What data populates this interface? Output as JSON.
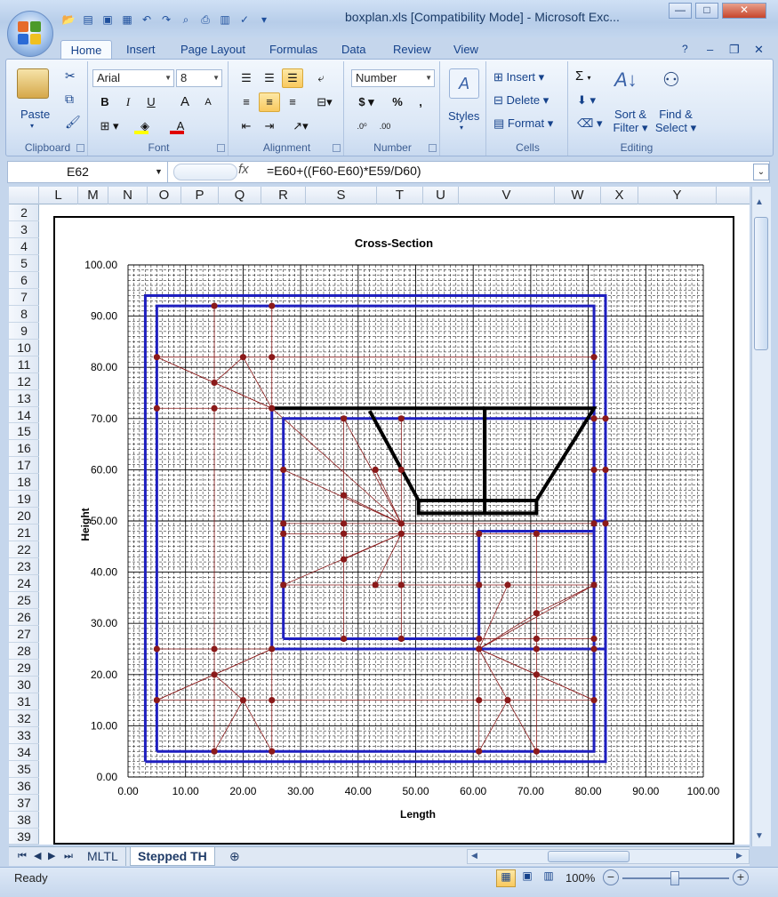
{
  "window": {
    "title": "boxplan.xls  [Compatibility Mode] - Microsoft Exc...",
    "minimize": "—",
    "maximize": "□",
    "close": "✕"
  },
  "ribbon_tabs": [
    "Home",
    "Insert",
    "Page Layout",
    "Formulas",
    "Data",
    "Review",
    "View"
  ],
  "clipboard": {
    "paste": "Paste",
    "label": "Clipboard"
  },
  "font": {
    "name": "Arial",
    "size": "8",
    "bold": "B",
    "italic": "I",
    "underline": "U",
    "grow": "A",
    "shrink": "A",
    "color_letter": "A",
    "label": "Font",
    "fill_color": "#ffff00",
    "text_color": "#e00000"
  },
  "alignment": {
    "label": "Alignment"
  },
  "number": {
    "format": "Number",
    "currency": "$",
    "percent": "%",
    "comma": ",",
    "label": "Number"
  },
  "styles": {
    "label": "Styles"
  },
  "cells": {
    "insert": "Insert",
    "delete": "Delete",
    "format": "Format",
    "label": "Cells"
  },
  "editing": {
    "sum": "Σ",
    "sort": "Sort &",
    "filter": "Filter",
    "find": "Find &",
    "select": "Select",
    "label": "Editing"
  },
  "formula_bar": {
    "name_box": "E62",
    "fx": "fx",
    "formula": "=E60+((F60-E60)*E59/D60)"
  },
  "columns": [
    "L",
    "M",
    "N",
    "O",
    "P",
    "Q",
    "R",
    "S",
    "T",
    "U",
    "V",
    "W",
    "X",
    "Y"
  ],
  "rows": [
    "2",
    "3",
    "4",
    "5",
    "6",
    "7",
    "8",
    "9",
    "10",
    "11",
    "12",
    "13",
    "14",
    "15",
    "16",
    "17",
    "18",
    "19",
    "20",
    "21",
    "22",
    "23",
    "24",
    "25",
    "26",
    "27",
    "28",
    "29",
    "30",
    "31",
    "32",
    "33",
    "34",
    "35",
    "36",
    "37",
    "38",
    "39"
  ],
  "sheet_tabs": [
    "MLTL",
    "Stepped TH"
  ],
  "status": {
    "ready": "Ready",
    "zoom": "100%"
  },
  "chart_data": {
    "type": "scatter",
    "title": "Cross-Section",
    "xlabel": "Length",
    "ylabel": "Height",
    "xlim": [
      0,
      100
    ],
    "ylim": [
      0,
      100
    ],
    "xticks": [
      "0.00",
      "10.00",
      "20.00",
      "30.00",
      "40.00",
      "50.00",
      "60.00",
      "70.00",
      "80.00",
      "90.00",
      "100.00"
    ],
    "yticks": [
      "0.00",
      "10.00",
      "20.00",
      "30.00",
      "40.00",
      "50.00",
      "60.00",
      "70.00",
      "80.00",
      "90.00",
      "100.00"
    ],
    "grid": true,
    "colors": {
      "box": "#1f1fbf",
      "mesh": "#8b1a1a",
      "hopper": "#000000"
    },
    "blue_boxes": [
      [
        [
          3,
          3
        ],
        [
          83,
          3
        ],
        [
          83,
          94
        ],
        [
          3,
          94
        ],
        [
          3,
          3
        ]
      ],
      [
        [
          5,
          5
        ],
        [
          81,
          5
        ],
        [
          81,
          92
        ],
        [
          5,
          92
        ],
        [
          5,
          92
        ],
        [
          5,
          5
        ]
      ],
      [
        [
          25,
          25
        ],
        [
          83,
          25
        ],
        [
          83,
          50
        ],
        [
          81,
          50
        ],
        [
          81,
          72
        ],
        [
          25,
          72
        ],
        [
          25,
          25
        ]
      ],
      [
        [
          27,
          27
        ],
        [
          61,
          27
        ],
        [
          61,
          48
        ],
        [
          81,
          48
        ],
        [
          81,
          70
        ],
        [
          27,
          70
        ],
        [
          27,
          27
        ]
      ]
    ],
    "hopper": [
      [
        42,
        71.5
      ],
      [
        50.5,
        54
      ],
      [
        50.5,
        51.5
      ],
      [
        71,
        51.5
      ],
      [
        71,
        54
      ],
      [
        62,
        54
      ],
      [
        62,
        72
      ],
      [
        81,
        72
      ],
      [
        71,
        54
      ]
    ],
    "hopper_frame": [
      [
        [
          62,
          72
        ],
        [
          25,
          72
        ]
      ],
      [
        [
          62,
          72
        ],
        [
          62,
          51.5
        ]
      ],
      [
        [
          50.5,
          54
        ],
        [
          71,
          54
        ]
      ]
    ],
    "mesh_lines": [
      [
        [
          15,
          92
        ],
        [
          15,
          77
        ]
      ],
      [
        [
          25,
          92
        ],
        [
          25,
          72
        ]
      ],
      [
        [
          5,
          82
        ],
        [
          15,
          77
        ]
      ],
      [
        [
          15,
          77
        ],
        [
          20,
          82
        ]
      ],
      [
        [
          20,
          82
        ],
        [
          25,
          72
        ]
      ],
      [
        [
          5,
          82
        ],
        [
          25,
          72
        ]
      ],
      [
        [
          15,
          77
        ],
        [
          25,
          72
        ]
      ],
      [
        [
          5,
          72
        ],
        [
          25,
          72
        ]
      ],
      [
        [
          15,
          72
        ],
        [
          15,
          5
        ]
      ],
      [
        [
          25,
          72
        ],
        [
          25,
          5
        ]
      ],
      [
        [
          5,
          25
        ],
        [
          81,
          25
        ]
      ],
      [
        [
          5,
          15
        ],
        [
          81,
          15
        ]
      ],
      [
        [
          25,
          72
        ],
        [
          47.5,
          49.5
        ]
      ],
      [
        [
          27,
          60
        ],
        [
          47.5,
          49.5
        ]
      ],
      [
        [
          37.5,
          55
        ],
        [
          47.5,
          49.5
        ]
      ],
      [
        [
          37.5,
          70
        ],
        [
          47.5,
          49.5
        ]
      ],
      [
        [
          43,
          60
        ],
        [
          47.5,
          49.5
        ]
      ],
      [
        [
          47.5,
          70
        ],
        [
          47.5,
          27
        ]
      ],
      [
        [
          27,
          49.5
        ],
        [
          81,
          49.5
        ]
      ],
      [
        [
          27,
          47.5
        ],
        [
          81,
          47.5
        ]
      ],
      [
        [
          37.5,
          70
        ],
        [
          37.5,
          27
        ]
      ],
      [
        [
          27,
          37.5
        ],
        [
          47.5,
          47.5
        ]
      ],
      [
        [
          37.5,
          42.5
        ],
        [
          47.5,
          47.5
        ]
      ],
      [
        [
          43,
          37.5
        ],
        [
          47.5,
          47.5
        ]
      ],
      [
        [
          27,
          37.5
        ],
        [
          81,
          37.5
        ]
      ],
      [
        [
          61,
          47.5
        ],
        [
          61,
          5
        ]
      ],
      [
        [
          71,
          47.5
        ],
        [
          71,
          5
        ]
      ],
      [
        [
          61,
          25
        ],
        [
          71,
          32
        ]
      ],
      [
        [
          61,
          25
        ],
        [
          81,
          37.5
        ]
      ],
      [
        [
          66,
          37.5
        ],
        [
          61,
          25
        ]
      ],
      [
        [
          61,
          25
        ],
        [
          71,
          20
        ]
      ],
      [
        [
          61,
          25
        ],
        [
          81,
          15
        ]
      ],
      [
        [
          61,
          25
        ],
        [
          66,
          15
        ]
      ],
      [
        [
          66,
          15
        ],
        [
          61,
          5
        ]
      ],
      [
        [
          66,
          15
        ],
        [
          71,
          5
        ]
      ],
      [
        [
          71,
          20
        ],
        [
          81,
          15
        ]
      ],
      [
        [
          71,
          32
        ],
        [
          81,
          37.5
        ]
      ],
      [
        [
          25,
          25
        ],
        [
          5,
          15
        ]
      ],
      [
        [
          25,
          25
        ],
        [
          15,
          20
        ]
      ],
      [
        [
          15,
          20
        ],
        [
          20,
          15
        ]
      ],
      [
        [
          20,
          15
        ],
        [
          15,
          5
        ]
      ],
      [
        [
          20,
          15
        ],
        [
          25,
          5
        ]
      ],
      [
        [
          15,
          20
        ],
        [
          5,
          15
        ]
      ],
      [
        [
          81,
          82
        ],
        [
          81,
          5
        ]
      ],
      [
        [
          83,
          72
        ],
        [
          83,
          48
        ]
      ],
      [
        [
          81,
          60
        ],
        [
          83,
          60
        ]
      ],
      [
        [
          81,
          70
        ],
        [
          83,
          70
        ]
      ],
      [
        [
          81,
          27
        ],
        [
          81,
          25
        ]
      ],
      [
        [
          61,
          27
        ],
        [
          81,
          27
        ]
      ],
      [
        [
          5,
          82
        ],
        [
          81,
          82
        ]
      ]
    ],
    "points": [
      [
        15,
        92
      ],
      [
        25,
        92
      ],
      [
        5,
        82
      ],
      [
        20,
        82
      ],
      [
        25,
        82
      ],
      [
        81,
        82
      ],
      [
        15,
        77
      ],
      [
        5,
        72
      ],
      [
        15,
        72
      ],
      [
        25,
        72
      ],
      [
        37.5,
        70
      ],
      [
        47.5,
        70
      ],
      [
        81,
        70
      ],
      [
        83,
        70
      ],
      [
        27,
        60
      ],
      [
        43,
        60
      ],
      [
        47.5,
        60
      ],
      [
        81,
        60
      ],
      [
        83,
        60
      ],
      [
        37.5,
        55
      ],
      [
        27,
        49.5
      ],
      [
        37.5,
        49.5
      ],
      [
        47.5,
        49.5
      ],
      [
        81,
        49.5
      ],
      [
        83,
        49.5
      ],
      [
        27,
        47.5
      ],
      [
        37.5,
        47.5
      ],
      [
        47.5,
        47.5
      ],
      [
        61,
        47.5
      ],
      [
        71,
        47.5
      ],
      [
        37.5,
        42.5
      ],
      [
        27,
        37.5
      ],
      [
        43,
        37.5
      ],
      [
        47.5,
        37.5
      ],
      [
        61,
        37.5
      ],
      [
        66,
        37.5
      ],
      [
        81,
        37.5
      ],
      [
        71,
        32
      ],
      [
        37.5,
        27
      ],
      [
        47.5,
        27
      ],
      [
        61,
        27
      ],
      [
        71,
        27
      ],
      [
        81,
        27
      ],
      [
        5,
        25
      ],
      [
        15,
        25
      ],
      [
        25,
        25
      ],
      [
        61,
        25
      ],
      [
        71,
        25
      ],
      [
        81,
        25
      ],
      [
        15,
        20
      ],
      [
        71,
        20
      ],
      [
        5,
        15
      ],
      [
        20,
        15
      ],
      [
        25,
        15
      ],
      [
        61,
        15
      ],
      [
        66,
        15
      ],
      [
        81,
        15
      ],
      [
        15,
        5
      ],
      [
        25,
        5
      ],
      [
        61,
        5
      ],
      [
        71,
        5
      ]
    ]
  }
}
